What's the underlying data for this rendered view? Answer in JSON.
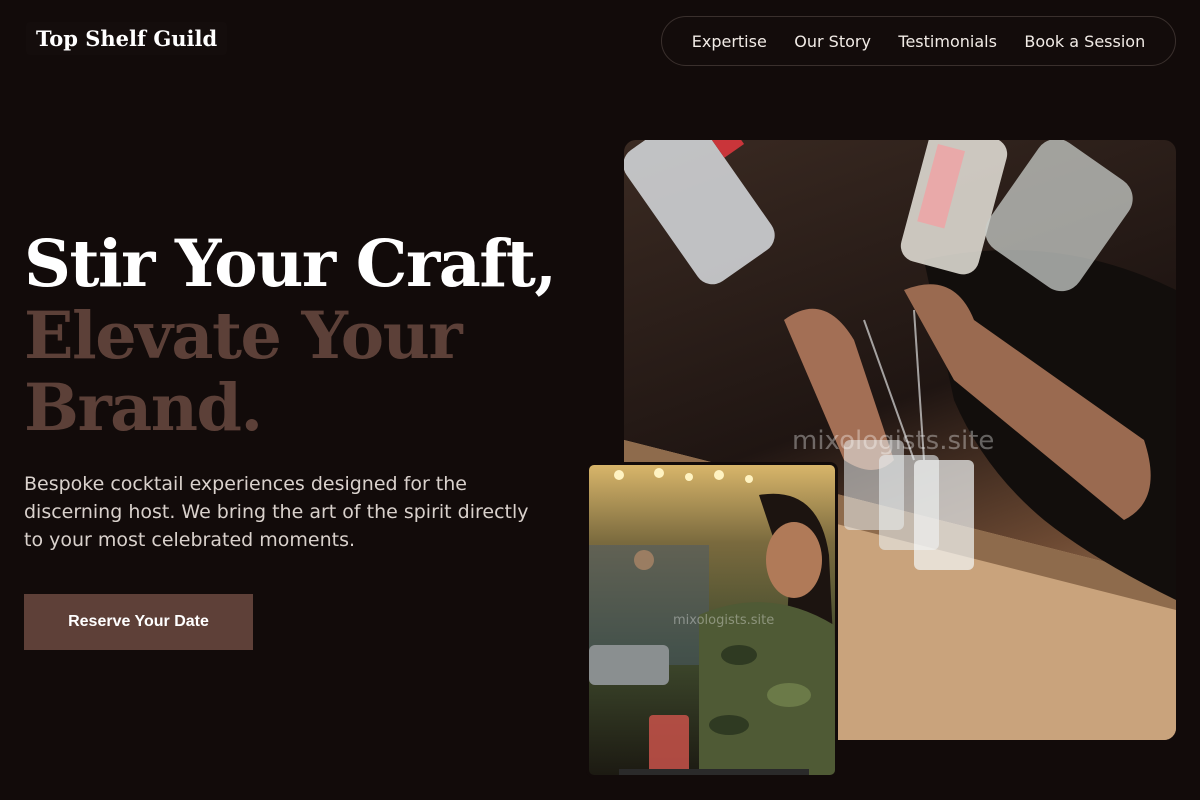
{
  "brand": {
    "name": "Top Shelf Guild"
  },
  "nav": {
    "items": [
      {
        "label": "Expertise"
      },
      {
        "label": "Our Story"
      },
      {
        "label": "Testimonials"
      },
      {
        "label": "Book a Session"
      }
    ]
  },
  "hero": {
    "headline_line1": "Stir Your Craft,",
    "headline_line2": "Elevate Your",
    "headline_line3": "Brand.",
    "lead": "Bespoke cocktail experiences designed for the discerning host. We bring the art of the spirit directly to your most celebrated moments.",
    "cta_label": "Reserve Your Date"
  },
  "images": {
    "main_watermark": "mixologists.site",
    "small_watermark": "mixologists.site"
  },
  "colors": {
    "background": "#120b0a",
    "accent": "#5e4038",
    "headline_accent": "#5c4038"
  }
}
